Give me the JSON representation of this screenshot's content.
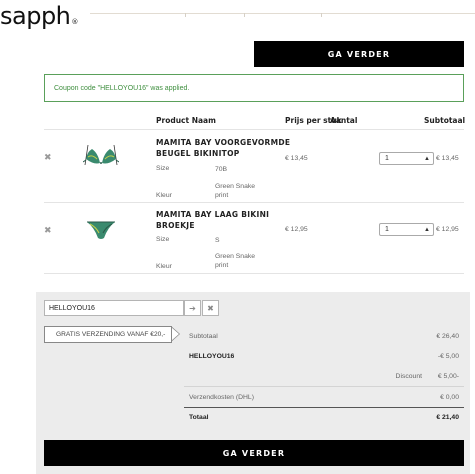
{
  "brand": {
    "name": "sapph",
    "mark": "®"
  },
  "buttons": {
    "continue_top": "GA VERDER",
    "continue_bottom": "GA VERDER"
  },
  "notice": {
    "text": "Coupon code \"HELLOYOU16\" was applied."
  },
  "table": {
    "headers": {
      "product": "Product Naam",
      "price": "Prijs per stuk",
      "quantity": "Aantal",
      "subtotal": "Subtotaal"
    },
    "size_label": "Size",
    "color_label": "Kleur",
    "items": [
      {
        "name_line1": "MAMITA BAY VOORGEVORMDE",
        "name_line2": "BEUGEL BIKINITOP",
        "size": "70B",
        "color_line1": "Green Snake",
        "color_line2": "print",
        "price": "€ 13,45",
        "quantity": "1",
        "subtotal": "€ 13,45"
      },
      {
        "name_line1": "MAMITA BAY LAAG BIKINI",
        "name_line2": "BROEKJE",
        "size": "S",
        "color_line1": "Green Snake",
        "color_line2": "print",
        "price": "€ 12,95",
        "quantity": "1",
        "subtotal": "€ 12,95"
      }
    ]
  },
  "coupon": {
    "value": "HELLOYOU16"
  },
  "shipping_notice": "GRATIS VERZENDING VANAF €20,-",
  "summary": {
    "subtotal_label": "Subtotaal",
    "subtotal_value": "€ 26,40",
    "coupon_label": "HELLOYOU16",
    "coupon_value": "-€ 5,00",
    "discount_label": "Discount",
    "discount_value": "€ 5,00-",
    "shipping_label": "Verzendkosten (DHL)",
    "shipping_value": "€ 0,00",
    "total_label": "Totaal",
    "total_value": "€ 21,40"
  },
  "colors": {
    "accent_green": "#3f8f3f",
    "button_black": "#000000",
    "panel_grey": "#ececec"
  },
  "icons": {
    "remove": "close-icon",
    "apply": "arrow-right-icon",
    "clear": "close-icon",
    "select": "updown-arrows-icon"
  }
}
